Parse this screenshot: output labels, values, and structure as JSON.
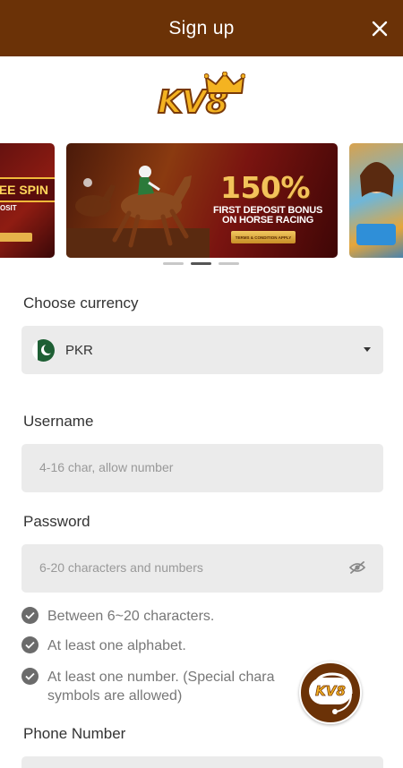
{
  "header": {
    "title": "Sign up",
    "close_icon": "close-icon"
  },
  "logo": {
    "text": "KV8"
  },
  "carousel": {
    "slides": [
      {
        "headline": "EE SPIN",
        "subtext": "OSIT"
      },
      {
        "big": "150%",
        "line1": "FIRST DEPOSIT BONUS",
        "line2": "ON HORSE RACING",
        "button": "TERMS & CONDITION APPLY"
      },
      {
        "headline": ""
      }
    ],
    "active_index": 1
  },
  "currency": {
    "label": "Choose currency",
    "value": "PKR"
  },
  "username": {
    "label": "Username",
    "placeholder": "4-16 char, allow number"
  },
  "password": {
    "label": "Password",
    "placeholder": "6-20 characters and numbers"
  },
  "password_rules": [
    {
      "text": "Between 6~20 characters."
    },
    {
      "text": "At least one alphabet."
    },
    {
      "text": "At least one number. (Special chara symbols are allowed)"
    }
  ],
  "phone": {
    "label": "Phone Number"
  },
  "support_button": {
    "text": "KV8"
  },
  "colors": {
    "brand": "#6b3207",
    "accent": "#f4b321",
    "field_bg": "#ebebeb"
  }
}
